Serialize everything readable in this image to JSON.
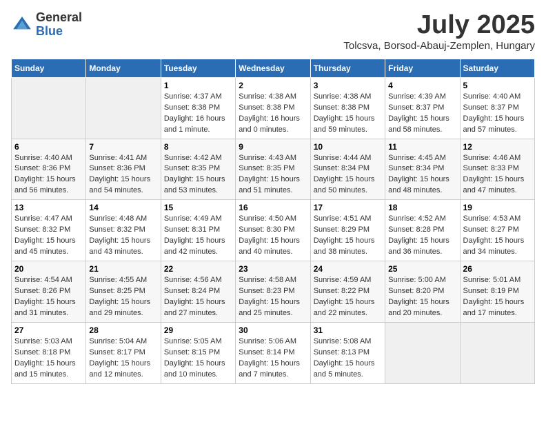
{
  "header": {
    "logo_general": "General",
    "logo_blue": "Blue",
    "month": "July 2025",
    "location": "Tolcsva, Borsod-Abauj-Zemplen, Hungary"
  },
  "weekdays": [
    "Sunday",
    "Monday",
    "Tuesday",
    "Wednesday",
    "Thursday",
    "Friday",
    "Saturday"
  ],
  "weeks": [
    [
      {
        "day": "",
        "info": ""
      },
      {
        "day": "",
        "info": ""
      },
      {
        "day": "1",
        "info": "Sunrise: 4:37 AM\nSunset: 8:38 PM\nDaylight: 16 hours and 1 minute."
      },
      {
        "day": "2",
        "info": "Sunrise: 4:38 AM\nSunset: 8:38 PM\nDaylight: 16 hours and 0 minutes."
      },
      {
        "day": "3",
        "info": "Sunrise: 4:38 AM\nSunset: 8:38 PM\nDaylight: 15 hours and 59 minutes."
      },
      {
        "day": "4",
        "info": "Sunrise: 4:39 AM\nSunset: 8:37 PM\nDaylight: 15 hours and 58 minutes."
      },
      {
        "day": "5",
        "info": "Sunrise: 4:40 AM\nSunset: 8:37 PM\nDaylight: 15 hours and 57 minutes."
      }
    ],
    [
      {
        "day": "6",
        "info": "Sunrise: 4:40 AM\nSunset: 8:36 PM\nDaylight: 15 hours and 56 minutes."
      },
      {
        "day": "7",
        "info": "Sunrise: 4:41 AM\nSunset: 8:36 PM\nDaylight: 15 hours and 54 minutes."
      },
      {
        "day": "8",
        "info": "Sunrise: 4:42 AM\nSunset: 8:35 PM\nDaylight: 15 hours and 53 minutes."
      },
      {
        "day": "9",
        "info": "Sunrise: 4:43 AM\nSunset: 8:35 PM\nDaylight: 15 hours and 51 minutes."
      },
      {
        "day": "10",
        "info": "Sunrise: 4:44 AM\nSunset: 8:34 PM\nDaylight: 15 hours and 50 minutes."
      },
      {
        "day": "11",
        "info": "Sunrise: 4:45 AM\nSunset: 8:34 PM\nDaylight: 15 hours and 48 minutes."
      },
      {
        "day": "12",
        "info": "Sunrise: 4:46 AM\nSunset: 8:33 PM\nDaylight: 15 hours and 47 minutes."
      }
    ],
    [
      {
        "day": "13",
        "info": "Sunrise: 4:47 AM\nSunset: 8:32 PM\nDaylight: 15 hours and 45 minutes."
      },
      {
        "day": "14",
        "info": "Sunrise: 4:48 AM\nSunset: 8:32 PM\nDaylight: 15 hours and 43 minutes."
      },
      {
        "day": "15",
        "info": "Sunrise: 4:49 AM\nSunset: 8:31 PM\nDaylight: 15 hours and 42 minutes."
      },
      {
        "day": "16",
        "info": "Sunrise: 4:50 AM\nSunset: 8:30 PM\nDaylight: 15 hours and 40 minutes."
      },
      {
        "day": "17",
        "info": "Sunrise: 4:51 AM\nSunset: 8:29 PM\nDaylight: 15 hours and 38 minutes."
      },
      {
        "day": "18",
        "info": "Sunrise: 4:52 AM\nSunset: 8:28 PM\nDaylight: 15 hours and 36 minutes."
      },
      {
        "day": "19",
        "info": "Sunrise: 4:53 AM\nSunset: 8:27 PM\nDaylight: 15 hours and 34 minutes."
      }
    ],
    [
      {
        "day": "20",
        "info": "Sunrise: 4:54 AM\nSunset: 8:26 PM\nDaylight: 15 hours and 31 minutes."
      },
      {
        "day": "21",
        "info": "Sunrise: 4:55 AM\nSunset: 8:25 PM\nDaylight: 15 hours and 29 minutes."
      },
      {
        "day": "22",
        "info": "Sunrise: 4:56 AM\nSunset: 8:24 PM\nDaylight: 15 hours and 27 minutes."
      },
      {
        "day": "23",
        "info": "Sunrise: 4:58 AM\nSunset: 8:23 PM\nDaylight: 15 hours and 25 minutes."
      },
      {
        "day": "24",
        "info": "Sunrise: 4:59 AM\nSunset: 8:22 PM\nDaylight: 15 hours and 22 minutes."
      },
      {
        "day": "25",
        "info": "Sunrise: 5:00 AM\nSunset: 8:20 PM\nDaylight: 15 hours and 20 minutes."
      },
      {
        "day": "26",
        "info": "Sunrise: 5:01 AM\nSunset: 8:19 PM\nDaylight: 15 hours and 17 minutes."
      }
    ],
    [
      {
        "day": "27",
        "info": "Sunrise: 5:03 AM\nSunset: 8:18 PM\nDaylight: 15 hours and 15 minutes."
      },
      {
        "day": "28",
        "info": "Sunrise: 5:04 AM\nSunset: 8:17 PM\nDaylight: 15 hours and 12 minutes."
      },
      {
        "day": "29",
        "info": "Sunrise: 5:05 AM\nSunset: 8:15 PM\nDaylight: 15 hours and 10 minutes."
      },
      {
        "day": "30",
        "info": "Sunrise: 5:06 AM\nSunset: 8:14 PM\nDaylight: 15 hours and 7 minutes."
      },
      {
        "day": "31",
        "info": "Sunrise: 5:08 AM\nSunset: 8:13 PM\nDaylight: 15 hours and 5 minutes."
      },
      {
        "day": "",
        "info": ""
      },
      {
        "day": "",
        "info": ""
      }
    ]
  ]
}
